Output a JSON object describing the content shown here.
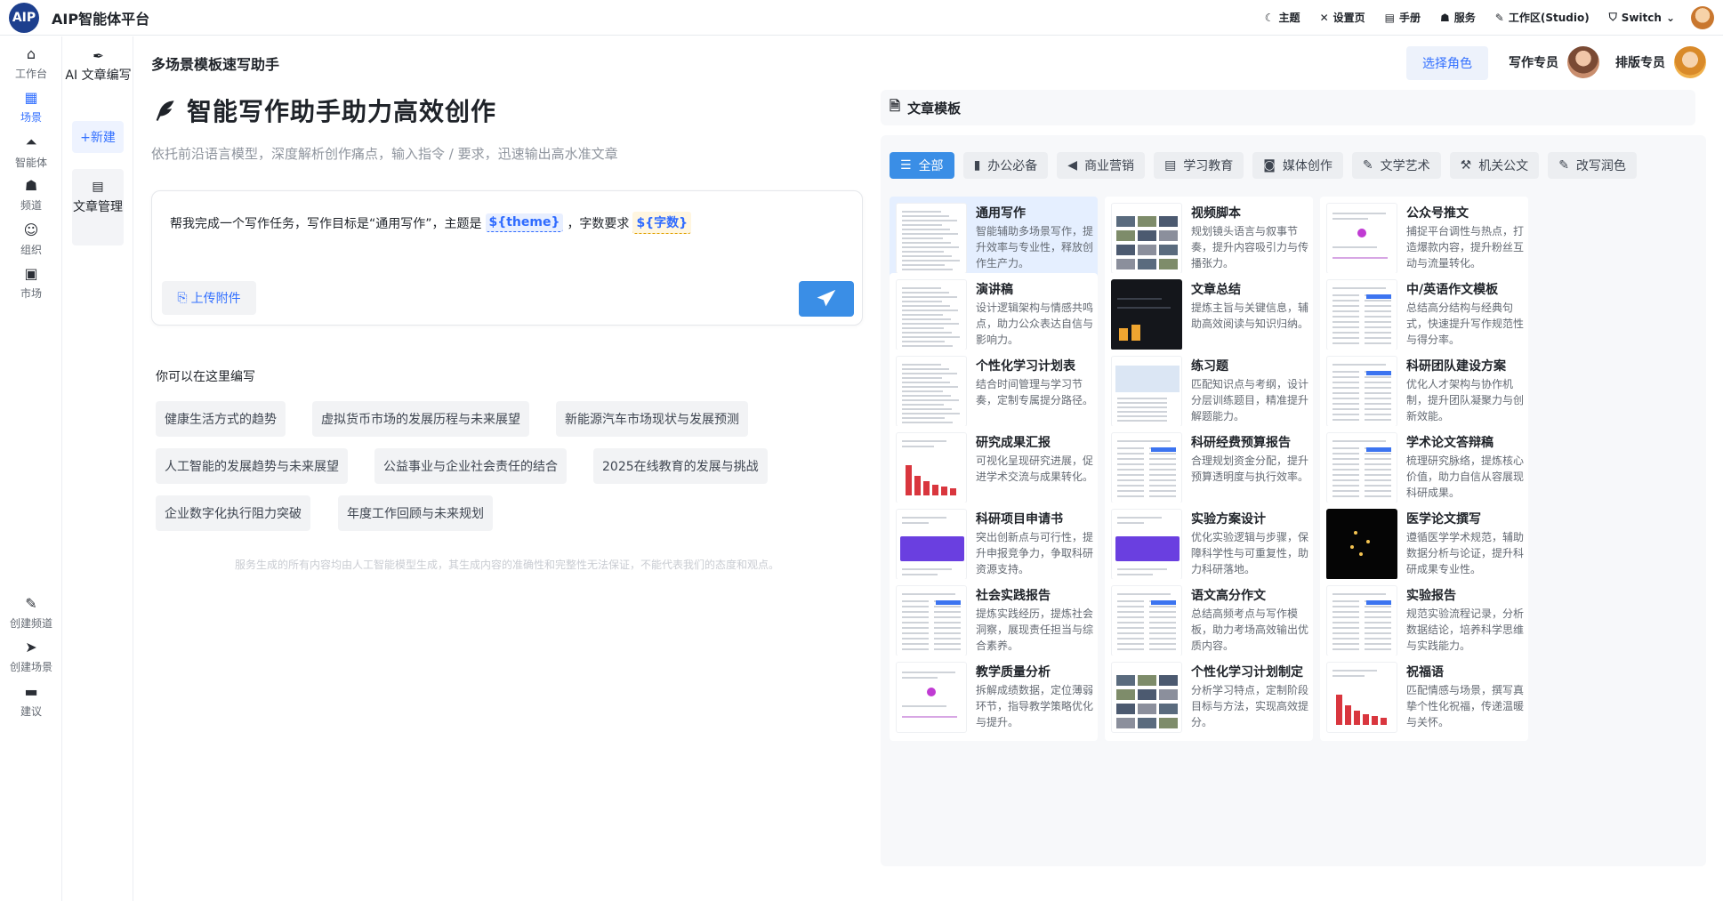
{
  "app": {
    "logo_text": "AIP",
    "brand": "AIP智能体平台"
  },
  "topnav": [
    {
      "label": "主题",
      "icon": "moon-icon",
      "glyph": "☾"
    },
    {
      "label": "设置页",
      "icon": "tools-icon",
      "glyph": "✕"
    },
    {
      "label": "手册",
      "icon": "document-icon",
      "glyph": "▤"
    },
    {
      "label": "服务",
      "icon": "users-icon",
      "glyph": "☗"
    },
    {
      "label": "工作区(Studio)",
      "icon": "pen-icon",
      "glyph": "✎"
    },
    {
      "label": "Switch",
      "icon": "shield-icon",
      "glyph": "⛉"
    }
  ],
  "rail": {
    "top": [
      {
        "label": "工作台",
        "glyph": "⌂",
        "key": "workbench"
      },
      {
        "label": "场景",
        "glyph": "▦",
        "key": "scene",
        "active": true
      },
      {
        "label": "智能体",
        "glyph": "⏶",
        "key": "agent"
      },
      {
        "label": "频道",
        "glyph": "☗",
        "key": "channel"
      },
      {
        "label": "组织",
        "glyph": "☺",
        "key": "org"
      },
      {
        "label": "市场",
        "glyph": "▣",
        "key": "market"
      }
    ],
    "bottom": [
      {
        "label": "创建频道",
        "glyph": "✎",
        "key": "create-channel"
      },
      {
        "label": "创建场景",
        "glyph": "➤",
        "key": "create-scene"
      },
      {
        "label": "建议",
        "glyph": "▬",
        "key": "feedback"
      }
    ]
  },
  "subrail": {
    "title": "AI 文章编写",
    "new_label": "+新建",
    "manage_label": "文章管理"
  },
  "header": {
    "page_title": "多场景模板速写助手",
    "role_button": "选择角色",
    "role1": "写作专员",
    "role2": "排版专员"
  },
  "hero": {
    "title": "智能写作助手助力高效创作",
    "subtitle": "依托前沿语言模型，深度解析创作痛点，输入指令 / 要求，迅速输出高水准文章"
  },
  "prompt": {
    "text_a": "帮我完成一个写作任务，写作目标是“通用写作”，主题是",
    "var1": "${theme}",
    "text_b": "，字数要求",
    "var2": "${字数}",
    "upload_label": "上传附件"
  },
  "suggestions": {
    "label": "你可以在这里编写",
    "items": [
      "健康生活方式的趋势",
      "虚拟货币市场的发展历程与未来展望",
      "新能源汽车市场现状与发展预测",
      "人工智能的发展趋势与未来展望",
      "公益事业与企业社会责任的结合",
      "2025在线教育的发展与挑战",
      "企业数字化执行阻力突破",
      "年度工作回顾与未来规划"
    ]
  },
  "disclaimer": "服务生成的所有内容均由人工智能模型生成，其生成内容的准确性和完整性无法保证，不能代表我们的态度和观点。",
  "templates": {
    "header": "文章模板",
    "tabs": [
      {
        "label": "全部",
        "glyph": "☰",
        "active": true
      },
      {
        "label": "办公必备",
        "glyph": "▮"
      },
      {
        "label": "商业营销",
        "glyph": "◀"
      },
      {
        "label": "学习教育",
        "glyph": "▤"
      },
      {
        "label": "媒体创作",
        "glyph": "◙"
      },
      {
        "label": "文学艺术",
        "glyph": "✎"
      },
      {
        "label": "机关公文",
        "glyph": "⚒"
      },
      {
        "label": "改写润色",
        "glyph": "✎"
      }
    ],
    "cards": [
      {
        "title": "通用写作",
        "desc": "智能辅助多场景写作，提升效率与专业性，释放创作生产力。",
        "thumb": "doc",
        "selected": true
      },
      {
        "title": "视频脚本",
        "desc": "规划镜头语言与叙事节奏，提升内容吸引力与传播张力。",
        "thumb": "photos"
      },
      {
        "title": "公众号推文",
        "desc": "捕捉平台调性与热点，打造爆款内容，提升粉丝互动与流量转化。",
        "thumb": "dot"
      },
      {
        "title": "演讲稿",
        "desc": "设计逻辑架构与情感共鸣点，助力公众表达自信与影响力。",
        "thumb": "doc"
      },
      {
        "title": "文章总结",
        "desc": "提炼主旨与关键信息，辅助高效阅读与知识归纳。",
        "thumb": "dark"
      },
      {
        "title": "中/英语作文模板",
        "desc": "总结高分结构与经典句式，快速提升写作规范性与得分率。",
        "thumb": "table"
      },
      {
        "title": "个性化学习计划表",
        "desc": "结合时间管理与学习节奏，定制专属提分路径。",
        "thumb": "doc"
      },
      {
        "title": "练习题",
        "desc": "匹配知识点与考纲，设计分层训练题目，精准提升解题能力。",
        "thumb": "map"
      },
      {
        "title": "科研团队建设方案",
        "desc": "优化人才架构与协作机制，提升团队凝聚力与创新效能。",
        "thumb": "table"
      },
      {
        "title": "研究成果汇报",
        "desc": "可视化呈现研究进展，促进学术交流与成果转化。",
        "thumb": "bars"
      },
      {
        "title": "科研经费预算报告",
        "desc": "合理规划资金分配，提升预算透明度与执行效率。",
        "thumb": "table"
      },
      {
        "title": "学术论文答辩稿",
        "desc": "梳理研究脉络，提炼核心价值，助力自信从容展现科研成果。",
        "thumb": "table"
      },
      {
        "title": "科研项目申请书",
        "desc": "突出创新点与可行性，提升申报竞争力，争取科研资源支持。",
        "thumb": "purple"
      },
      {
        "title": "实验方案设计",
        "desc": "优化实验逻辑与步骤，保障科学性与可重复性，助力科研落地。",
        "thumb": "purple"
      },
      {
        "title": "医学论文撰写",
        "desc": "遵循医学学术规范，辅助数据分析与论证，提升科研成果专业性。",
        "thumb": "black"
      },
      {
        "title": "社会实践报告",
        "desc": "提炼实践经历，提炼社会洞察，展现责任担当与综合素养。",
        "thumb": "table"
      },
      {
        "title": "语文高分作文",
        "desc": "总结高频考点与写作模板，助力考场高效输出优质内容。",
        "thumb": "table"
      },
      {
        "title": "实验报告",
        "desc": "规范实验流程记录，分析数据结论，培养科学思维与实践能力。",
        "thumb": "table"
      },
      {
        "title": "教学质量分析",
        "desc": "拆解成绩数据，定位薄弱环节，指导教学策略优化与提升。",
        "thumb": "dot"
      },
      {
        "title": "个性化学习计划制定",
        "desc": "分析学习特点，定制阶段目标与方法，实现高效提分。",
        "thumb": "photos"
      },
      {
        "title": "祝福语",
        "desc": "匹配情感与场景，撰写真挚个性化祝福，传递温暖与关怀。",
        "thumb": "bars"
      }
    ]
  },
  "colors": {
    "accent": "#3370ff",
    "send_button": "#3a8ee6",
    "logo_bg": "#1d3f8e"
  }
}
